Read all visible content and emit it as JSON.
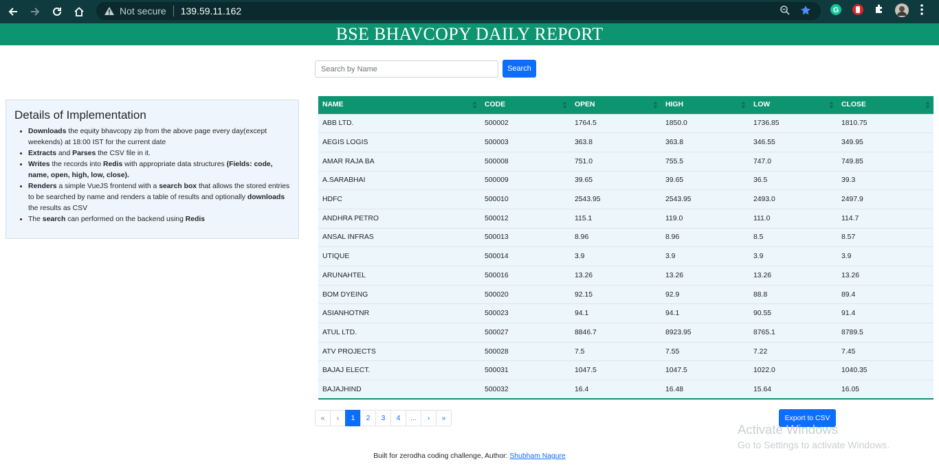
{
  "browser": {
    "security_label": "Not secure",
    "url": "139.59.11.162"
  },
  "page": {
    "title": "BSE BHAVCOPY DAILY REPORT"
  },
  "search": {
    "placeholder": "Search by Name",
    "button_label": "Search"
  },
  "details": {
    "heading": "Details of Implementation",
    "items": [
      [
        "Downloads",
        " the equity bhavcopy zip from the above page every day(except weekends) at 18:00 IST for the current date"
      ],
      [
        "Extracts",
        " and ",
        "Parses",
        " the CSV file in it."
      ],
      [
        "Writes",
        " the records into ",
        "Redis",
        " with appropriate data structures ",
        "(Fields: code, name, open, high, low, close)."
      ],
      [
        "Renders",
        " a simple VueJS frontend with a ",
        "search box",
        " that allows the stored entries to be searched by name and renders a table of results and optionally ",
        "downloads",
        " the results as CSV"
      ],
      [
        "The ",
        "search",
        " can performed on the backend using ",
        "Redis"
      ]
    ]
  },
  "table": {
    "headers": [
      "NAME",
      "CODE",
      "OPEN",
      "HIGH",
      "LOW",
      "CLOSE"
    ],
    "rows": [
      [
        "ABB LTD.",
        "500002",
        "1764.5",
        "1850.0",
        "1736.85",
        "1810.75"
      ],
      [
        "AEGIS LOGIS",
        "500003",
        "363.8",
        "363.8",
        "346.55",
        "349.95"
      ],
      [
        "AMAR RAJA BA",
        "500008",
        "751.0",
        "755.5",
        "747.0",
        "749.85"
      ],
      [
        "A.SARABHAI",
        "500009",
        "39.65",
        "39.65",
        "36.5",
        "39.3"
      ],
      [
        "HDFC",
        "500010",
        "2543.95",
        "2543.95",
        "2493.0",
        "2497.9"
      ],
      [
        "ANDHRA PETRO",
        "500012",
        "115.1",
        "119.0",
        "111.0",
        "114.7"
      ],
      [
        "ANSAL INFRAS",
        "500013",
        "8.96",
        "8.96",
        "8.5",
        "8.57"
      ],
      [
        "UTIQUE",
        "500014",
        "3.9",
        "3.9",
        "3.9",
        "3.9"
      ],
      [
        "ARUNAHTEL",
        "500016",
        "13.26",
        "13.26",
        "13.26",
        "13.26"
      ],
      [
        "BOM DYEING",
        "500020",
        "92.15",
        "92.9",
        "88.8",
        "89.4"
      ],
      [
        "ASIANHOTNR",
        "500023",
        "94.1",
        "94.1",
        "90.55",
        "91.4"
      ],
      [
        "ATUL LTD.",
        "500027",
        "8846.7",
        "8923.95",
        "8765.1",
        "8789.5"
      ],
      [
        "ATV PROJECTS",
        "500028",
        "7.5",
        "7.55",
        "7.22",
        "7.45"
      ],
      [
        "BAJAJ ELECT.",
        "500031",
        "1047.5",
        "1047.5",
        "1022.0",
        "1040.35"
      ],
      [
        "BAJAJHIND",
        "500032",
        "16.4",
        "16.48",
        "15.64",
        "16.05"
      ]
    ]
  },
  "pagination": {
    "items": [
      "«",
      "‹",
      "1",
      "2",
      "3",
      "4",
      "...",
      "›",
      "»"
    ],
    "active": "1"
  },
  "export": {
    "label": "Export to CSV"
  },
  "watermark": {
    "line1": "Activate Windows",
    "line2": "Go to Settings to activate Windows."
  },
  "footer": {
    "text": "Built for zerodha coding challenge, Author: ",
    "author": "Shubham Nagure"
  },
  "colors": {
    "header_green": "#0d9470",
    "primary_blue": "#0d6efd",
    "chrome_bg": "#0f3a3e"
  }
}
